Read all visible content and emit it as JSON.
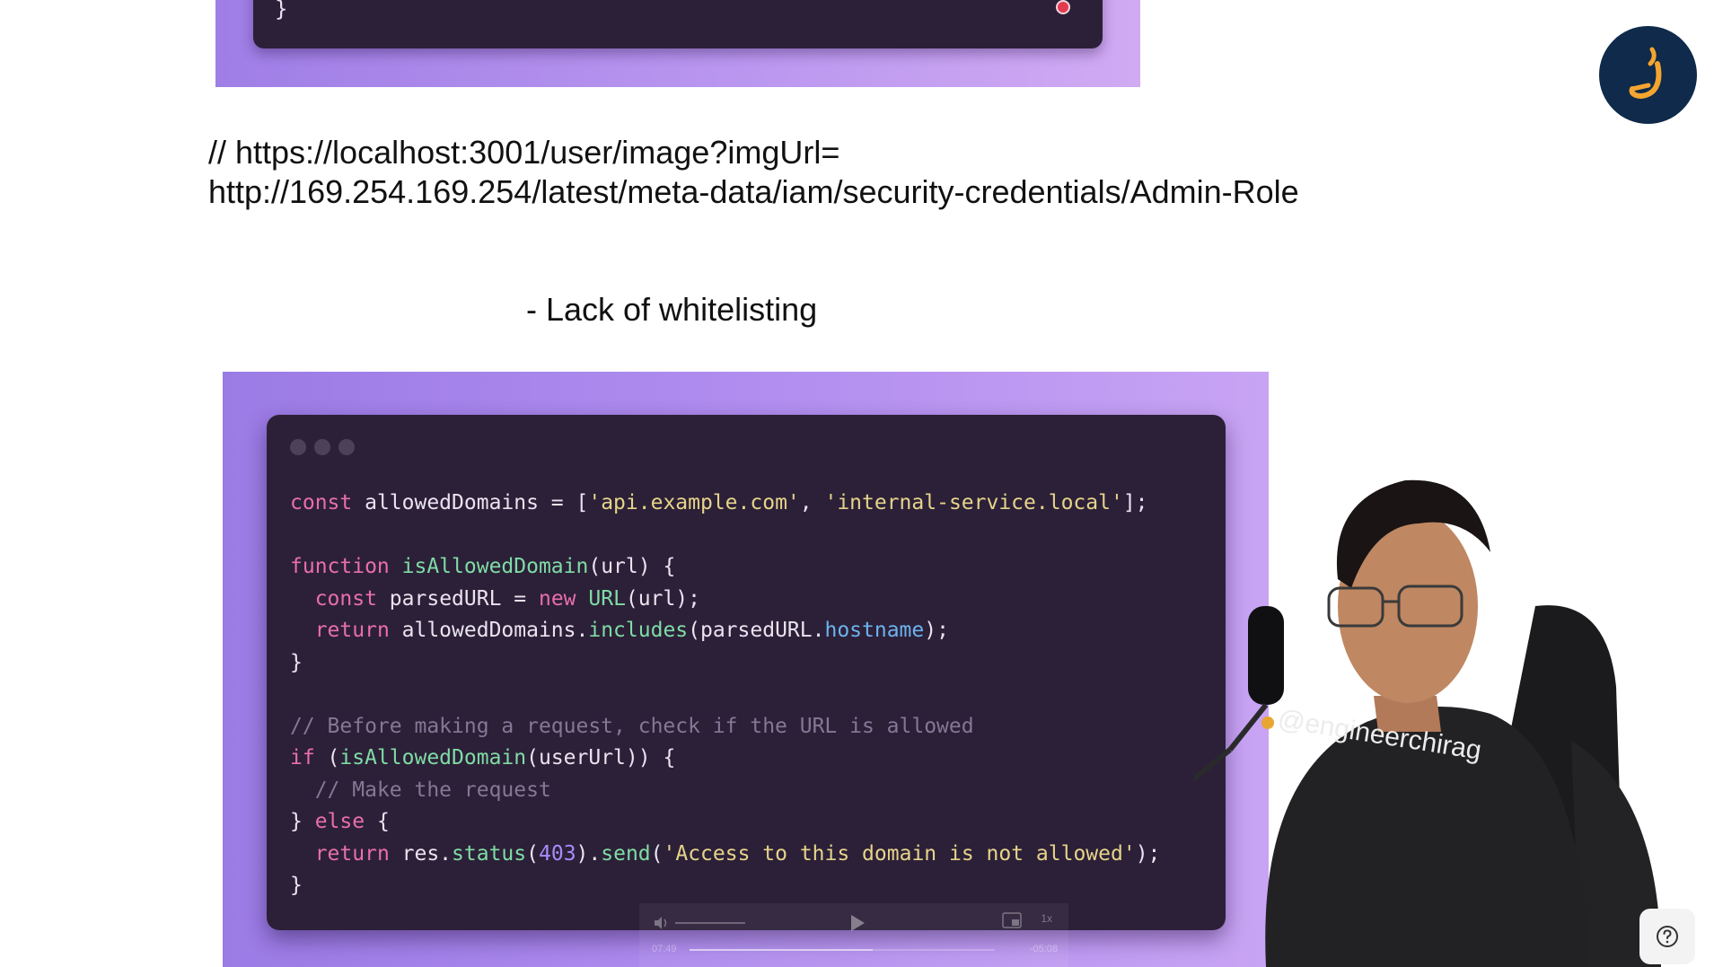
{
  "top_card": {
    "closing_brace": "}"
  },
  "comment_url": {
    "line1": "// https://localhost:3001/user/image?imgUrl=",
    "line2": "http://169.254.169.254/latest/meta-data/iam/security-credentials/Admin-Role"
  },
  "heading": "- Lack of whitelisting",
  "code_lines": [
    [
      {
        "t": "k",
        "v": "const"
      },
      {
        "t": "p",
        "v": " allowedDomains = ["
      },
      {
        "t": "s",
        "v": "'api.example.com'"
      },
      {
        "t": "p",
        "v": ", "
      },
      {
        "t": "s",
        "v": "'internal-service.local'"
      },
      {
        "t": "p",
        "v": "];"
      }
    ],
    [],
    [
      {
        "t": "k",
        "v": "function"
      },
      {
        "t": "p",
        "v": " "
      },
      {
        "t": "f",
        "v": "isAllowedDomain"
      },
      {
        "t": "p",
        "v": "(url) {"
      }
    ],
    [
      {
        "t": "p",
        "v": "  "
      },
      {
        "t": "k",
        "v": "const"
      },
      {
        "t": "p",
        "v": " parsedURL = "
      },
      {
        "t": "k",
        "v": "new"
      },
      {
        "t": "p",
        "v": " "
      },
      {
        "t": "f",
        "v": "URL"
      },
      {
        "t": "p",
        "v": "(url);"
      }
    ],
    [
      {
        "t": "p",
        "v": "  "
      },
      {
        "t": "k",
        "v": "return"
      },
      {
        "t": "p",
        "v": " allowedDomains."
      },
      {
        "t": "f",
        "v": "includes"
      },
      {
        "t": "p",
        "v": "(parsedURL."
      },
      {
        "t": "prop",
        "v": "hostname"
      },
      {
        "t": "p",
        "v": ");"
      }
    ],
    [
      {
        "t": "p",
        "v": "}"
      }
    ],
    [],
    [
      {
        "t": "c",
        "v": "// Before making a request, check if the URL is allowed"
      }
    ],
    [
      {
        "t": "k",
        "v": "if"
      },
      {
        "t": "p",
        "v": " ("
      },
      {
        "t": "f",
        "v": "isAllowedDomain"
      },
      {
        "t": "p",
        "v": "(userUrl)) {"
      }
    ],
    [
      {
        "t": "p",
        "v": "  "
      },
      {
        "t": "c",
        "v": "// Make the request"
      }
    ],
    [
      {
        "t": "p",
        "v": "} "
      },
      {
        "t": "k",
        "v": "else"
      },
      {
        "t": "p",
        "v": " {"
      }
    ],
    [
      {
        "t": "p",
        "v": "  "
      },
      {
        "t": "k",
        "v": "return"
      },
      {
        "t": "p",
        "v": " res."
      },
      {
        "t": "f",
        "v": "status"
      },
      {
        "t": "p",
        "v": "("
      },
      {
        "t": "n",
        "v": "403"
      },
      {
        "t": "p",
        "v": ")."
      },
      {
        "t": "f",
        "v": "send"
      },
      {
        "t": "p",
        "v": "("
      },
      {
        "t": "s",
        "v": "'Access to this domain is not allowed'"
      },
      {
        "t": "p",
        "v": ");"
      }
    ],
    [
      {
        "t": "p",
        "v": "}"
      }
    ]
  ],
  "player": {
    "time_current": "07:49",
    "time_remaining": "-05:08",
    "speed": "1x",
    "progress_fraction": 0.6,
    "icons": [
      "volume-icon",
      "play-icon",
      "pip-icon"
    ]
  },
  "presenter": {
    "shirt_handle": "@engineerchirag"
  },
  "colors": {
    "code_background": "#2c2038",
    "frame_gradient_start": "#9b7be5",
    "frame_gradient_end": "#c9a4f4",
    "keyword": "#e86fa7",
    "string": "#e6d48a",
    "function": "#7fdca5",
    "property": "#6db3ee",
    "number": "#a78bfa",
    "comment": "#837896",
    "logo_background": "#0f2a4a",
    "logo_accent": "#f4a530"
  }
}
